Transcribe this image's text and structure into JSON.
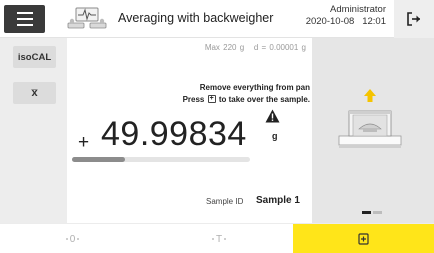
{
  "header": {
    "title": "Averaging with backweigher",
    "user": "Administrator",
    "datetime": "2020-10-08   12:01",
    "menu_icon": "hamburger-menu-icon",
    "app_icon": "backweigher-scale-icon",
    "logout_icon": "logout-icon"
  },
  "left_toolbar": {
    "isocal_label": "isoCAL",
    "mean_label": "x̅"
  },
  "weighing": {
    "meta": "Max 220 g   d = 0.00001 g",
    "instruction_line1": "Remove everything from pan",
    "instruction_line2_before": "Press",
    "instruction_line2_after": "to take over the sample.",
    "sign": "+",
    "value": "49.99834",
    "unit": "g",
    "progress_fraction": 0.3,
    "warning_icon": "warning-icon"
  },
  "sample": {
    "label": "Sample ID",
    "value": "Sample 1"
  },
  "pager": {
    "current": 1,
    "total": 2
  },
  "footer": {
    "zero_label": "0",
    "tare_label": "T",
    "take_icon": "take-over-icon"
  },
  "colors": {
    "accent_yellow": "#ffe519",
    "menu_dark": "#3a3a3a",
    "panel_grey": "#e6e6e6",
    "arrow_yellow": "#f5c400"
  }
}
